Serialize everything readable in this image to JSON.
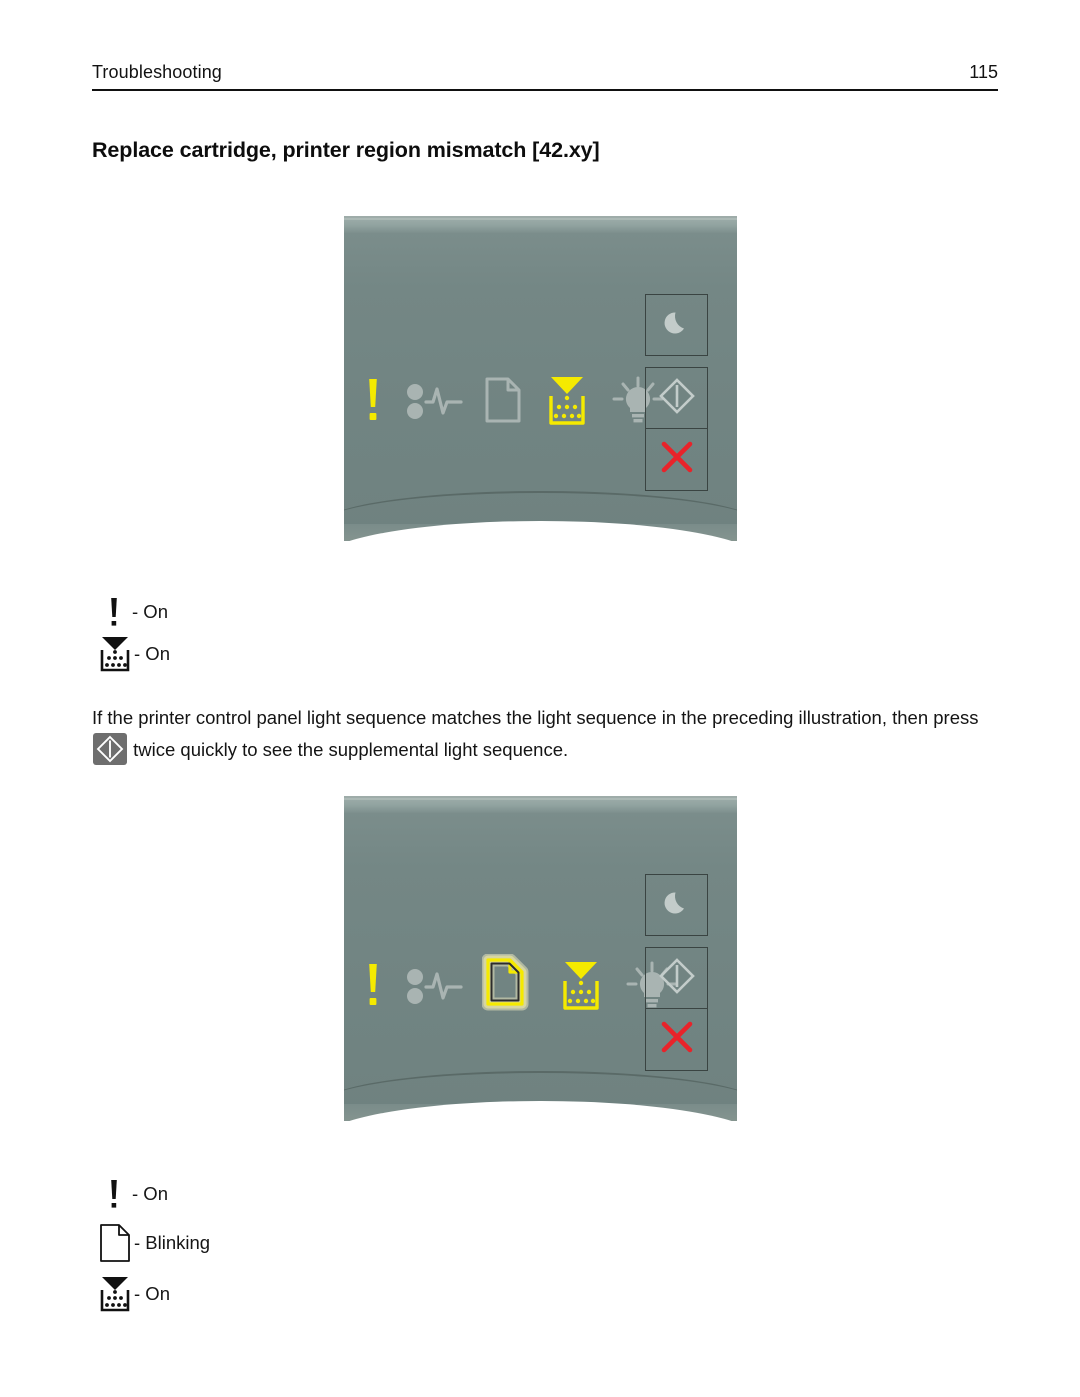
{
  "header": {
    "title": "Troubleshooting",
    "page_number": "115"
  },
  "heading": "Replace cartridge, printer region mismatch [42.xy]",
  "colors": {
    "light_on": "#F5EA00",
    "light_off": "#A9B4B2",
    "panel_face": "#718482",
    "cancel_red": "#E8232A",
    "button_border": "#3A4442",
    "inline_button_bg": "#6E6E6E"
  },
  "panels": [
    {
      "name": "primary-light-sequence",
      "lights": [
        {
          "icon": "error-exclamation-icon",
          "label": "Error",
          "state": "on"
        },
        {
          "icon": "paper-jam-icon",
          "label": "Paper Jam",
          "state": "off"
        },
        {
          "icon": "load-paper-icon",
          "label": "Load Paper",
          "state": "off"
        },
        {
          "icon": "toner-low-icon",
          "label": "Toner Low",
          "state": "on"
        },
        {
          "icon": "ready-lightbulb-icon",
          "label": "Ready",
          "state": "off"
        }
      ],
      "buttons": [
        {
          "icon": "sleep-moon-icon",
          "label": "Sleep"
        },
        {
          "icon": "start-diamond-icon",
          "label": "Start"
        },
        {
          "icon": "cancel-x-icon",
          "label": "Cancel"
        }
      ]
    },
    {
      "name": "supplemental-light-sequence",
      "lights": [
        {
          "icon": "error-exclamation-icon",
          "label": "Error",
          "state": "on"
        },
        {
          "icon": "paper-jam-icon",
          "label": "Paper Jam",
          "state": "off"
        },
        {
          "icon": "load-paper-icon",
          "label": "Load Paper",
          "state": "blinking"
        },
        {
          "icon": "toner-low-icon",
          "label": "Toner Low",
          "state": "on"
        },
        {
          "icon": "ready-lightbulb-icon",
          "label": "Ready",
          "state": "off"
        }
      ],
      "buttons": [
        {
          "icon": "sleep-moon-icon",
          "label": "Sleep"
        },
        {
          "icon": "start-diamond-icon",
          "label": "Start"
        },
        {
          "icon": "cancel-x-icon",
          "label": "Cancel"
        }
      ]
    }
  ],
  "legend_primary": [
    {
      "icon": "error-exclamation-icon",
      "text": "- On"
    },
    {
      "icon": "toner-low-icon",
      "text": "- On"
    }
  ],
  "legend_supplemental": [
    {
      "icon": "error-exclamation-icon",
      "text": "- On"
    },
    {
      "icon": "load-paper-icon",
      "text": "- Blinking"
    },
    {
      "icon": "toner-low-icon",
      "text": "- On"
    }
  ],
  "paragraph": {
    "part1": "If the printer control panel light sequence matches the light sequence in the preceding illustration, then press",
    "inline_icon": "start-diamond-icon",
    "part2": "twice quickly to see the supplemental light sequence."
  }
}
